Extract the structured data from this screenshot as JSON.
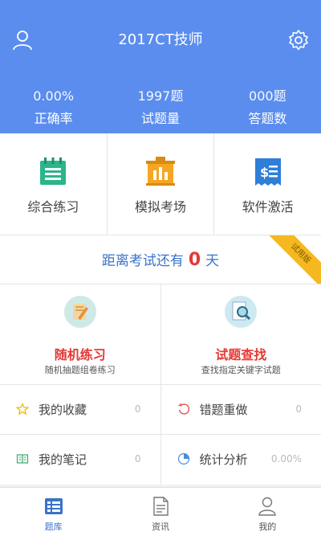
{
  "header": {
    "title": "2017CT技师",
    "user_icon": "user-icon",
    "settings_icon": "gear-icon",
    "color": "#5b8def"
  },
  "stats": [
    {
      "value": "0.00%",
      "label": "正确率"
    },
    {
      "value": "1997题",
      "label": "试题量"
    },
    {
      "value": "000题",
      "label": "答题数"
    }
  ],
  "modes": [
    {
      "label": "综合练习",
      "icon": "notebook-icon",
      "color": "#2bb58a"
    },
    {
      "label": "模拟考场",
      "icon": "exam-board-icon",
      "color": "#f5a623"
    },
    {
      "label": "软件激活",
      "icon": "receipt-icon",
      "color": "#2f7ed8"
    }
  ],
  "countdown": {
    "prefix": "距离考试还有",
    "days": "0",
    "suffix": "天",
    "ribbon": "试用版"
  },
  "big_tiles": [
    {
      "title": "随机练习",
      "subtitle": "随机抽题组卷练习",
      "icon": "random-practice-icon"
    },
    {
      "title": "试题查找",
      "subtitle": "查找指定关键字试题",
      "icon": "search-document-icon"
    }
  ],
  "list_items": [
    {
      "label": "我的收藏",
      "value": "0",
      "icon": "star-icon"
    },
    {
      "label": "错题重做",
      "value": "0",
      "icon": "redo-icon"
    },
    {
      "label": "我的笔记",
      "value": "0",
      "icon": "notes-icon"
    },
    {
      "label": "统计分析",
      "value": "0.00%",
      "icon": "pie-chart-icon"
    }
  ],
  "tabs": [
    {
      "label": "题库",
      "icon": "question-bank-icon",
      "active": true
    },
    {
      "label": "资讯",
      "icon": "news-icon",
      "active": false
    },
    {
      "label": "我的",
      "icon": "profile-icon",
      "active": false
    }
  ],
  "colors": {
    "accent": "#3a73c9",
    "red": "#e53935",
    "ribbon": "#f5b820"
  }
}
